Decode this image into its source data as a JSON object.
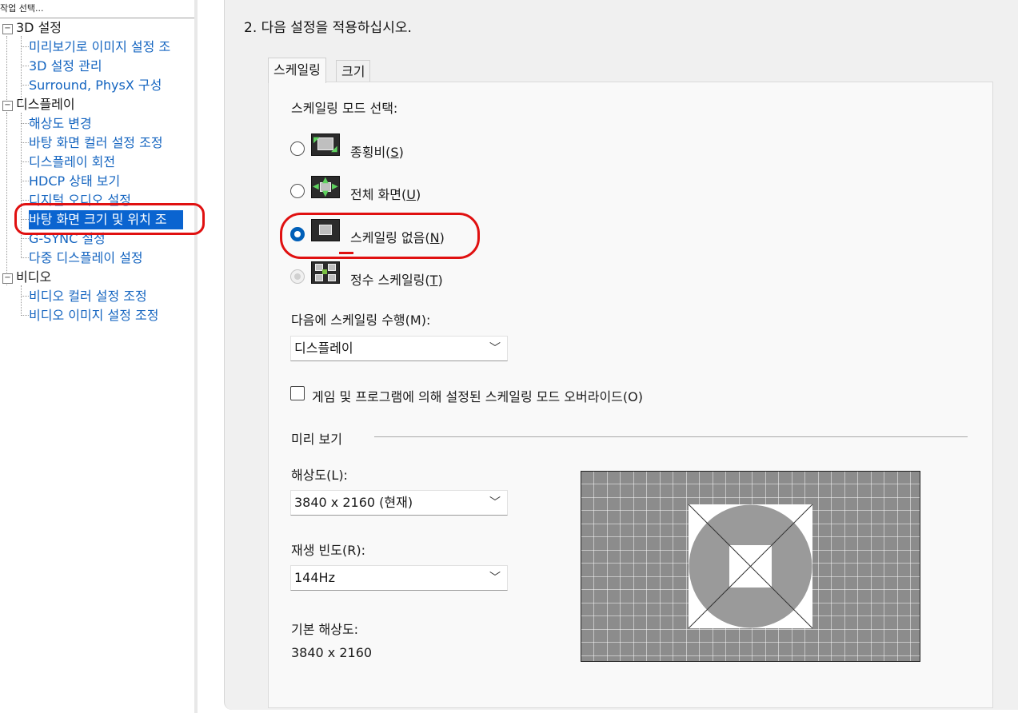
{
  "left_panel": {
    "caption": "작업 선택...",
    "groups": [
      {
        "label": "3D 설정",
        "toggle": "−",
        "items": [
          "미리보기로 이미지 설정 조",
          "3D 설정 관리",
          "Surround, PhysX 구성"
        ]
      },
      {
        "label": "디스플레이",
        "toggle": "−",
        "items": [
          "해상도 변경",
          "바탕 화면 컬러 설정 조정",
          "디스플레이 회전",
          "HDCP 상태 보기",
          "디지털 오디오 설정",
          "바탕 화면 크기 및 위치 조",
          "G-SYNC 설정",
          "다중 디스플레이 설정"
        ]
      },
      {
        "label": "비디오",
        "toggle": "−",
        "items": [
          "비디오 컬러 설정 조정",
          "비디오 이미지 설정 조정"
        ]
      }
    ],
    "selected_item": "바탕 화면 크기 및 위치 조"
  },
  "main": {
    "step_title": "2. 다음 설정을 적용하십시오.",
    "tabs": [
      {
        "label": "스케일링",
        "active": true
      },
      {
        "label": "크기",
        "active": false
      }
    ],
    "scaling_mode_label": "스케일링 모드 선택:",
    "modes": [
      {
        "label": "종횡비(",
        "key": "S",
        "close": ")",
        "checked": false,
        "disabled": false,
        "icon": "aspect-ratio-icon"
      },
      {
        "label": "전체 화면(",
        "key": "U",
        "close": ")",
        "checked": false,
        "disabled": false,
        "icon": "fullscreen-icon"
      },
      {
        "label": "스케일링 없음(",
        "key": "N",
        "close": ")",
        "checked": true,
        "disabled": false,
        "icon": "no-scaling-icon"
      },
      {
        "label": "정수 스케일링(",
        "key": "T",
        "close": ")",
        "checked": false,
        "disabled": true,
        "icon": "integer-scaling-icon"
      }
    ],
    "perform_on_label": "다음에 스케일링 수행(M):",
    "perform_on_value": "디스플레이",
    "override_label": "게임 및 프로그램에 의해 설정된 스케일링 모드 오버라이드(O)",
    "override_checked": false,
    "preview_label": "미리 보기",
    "resolution_label": "해상도(L):",
    "resolution_value": "3840 x 2160 (현재)",
    "refresh_label": "재생 빈도(R):",
    "refresh_value": "144Hz",
    "native_label": "기본 해상도:",
    "native_value": "3840 x 2160"
  },
  "colors": {
    "accent": "#005fb8",
    "selection": "#0a64d0",
    "link": "#1565c0",
    "annotation": "#e01010",
    "preview_grid": "#8c8c8c"
  }
}
